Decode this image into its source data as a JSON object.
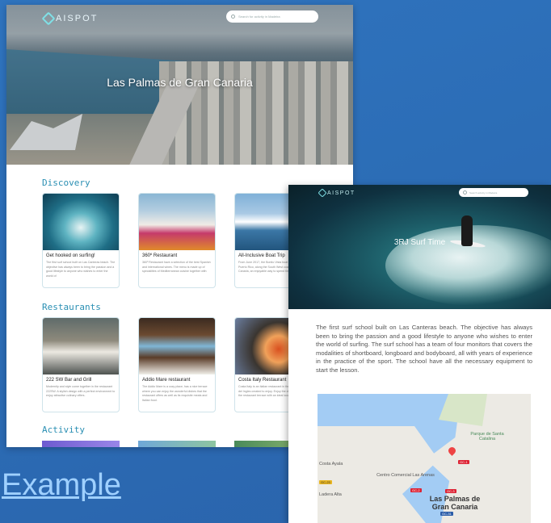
{
  "back_window": {
    "brand": "AISPOT",
    "search_placeholder": "Search for activity in Madeira",
    "hero_title": "Las Palmas de Gran Canaria",
    "sections": [
      {
        "title": "Discovery",
        "cards": [
          {
            "title": "Get hooked on surfing!",
            "desc": "The first surf school built on Las Canteras beach. The objective has always been to bring the passion and a good lifestyle to anyone who wishes to enter the world of"
          },
          {
            "title": "360º Restaurant",
            "desc": "360º Restaurant have a selection of the best Spanish and international wines. The menu is made up of specialities of Mediterranean cuisine together with"
          },
          {
            "title": "All-Inclusive Boat Trip",
            "desc": "From June 2017, the Bonito Vista boat operate from Puerto Rico, along the South West coast of Gran Canaria, an enjoyable way to spend time on the Atlantic"
          }
        ]
      },
      {
        "title": "Restaurants",
        "cards": [
          {
            "title": "222 SW Bar and Grill",
            "desc": "Modernity and style come together in the restaurant 222SW. A stylish design with a perfect environment to enjoy attractive culinary offers."
          },
          {
            "title": "Addio Mare restaurant",
            "desc": "The Addio Mare is a cozy place, has a nice terrace where you can enjoy the wonderful dishes that the restaurant offers as well as its exquisite meats and Italian food."
          },
          {
            "title": "Costa Italy Restaurant",
            "desc": "Costa Italy is an Italian restaurant in the heart of Playa del Ingles created to enjoy. Enjoy the delicious food on the restaurant terrace with an ideal location to the"
          }
        ]
      },
      {
        "title": "Activity",
        "cards": []
      }
    ]
  },
  "front_window": {
    "brand": "AISPOT",
    "search_placeholder": "Search activity in Madeira",
    "hero_title": "3RJ Surf Time",
    "description": "The first surf school built on Las Canteras beach. The objective has always been to bring the passion and a good lifestyle to anyone who wishes to enter the world of surfing. The surf school has a team of four monitors that covers the modalities of shortboard, longboard and bodyboard, all with years of experience in the practice of the sport. The school have all the necessary equipment to start the lesson.",
    "map": {
      "labels": {
        "park": "Parque de Santa Catalina",
        "costa_ayala": "Costa Ayala",
        "centro": "Centro Comercial Las Arenas",
        "ladera": "Ladera Alta",
        "city_line1": "Las Palmas de",
        "city_line2": "Gran Canaria"
      },
      "road_shields": [
        "GC-1",
        "GC-2",
        "GC-23",
        "GC-3",
        "GC-31"
      ]
    }
  },
  "footer_link": "Example"
}
